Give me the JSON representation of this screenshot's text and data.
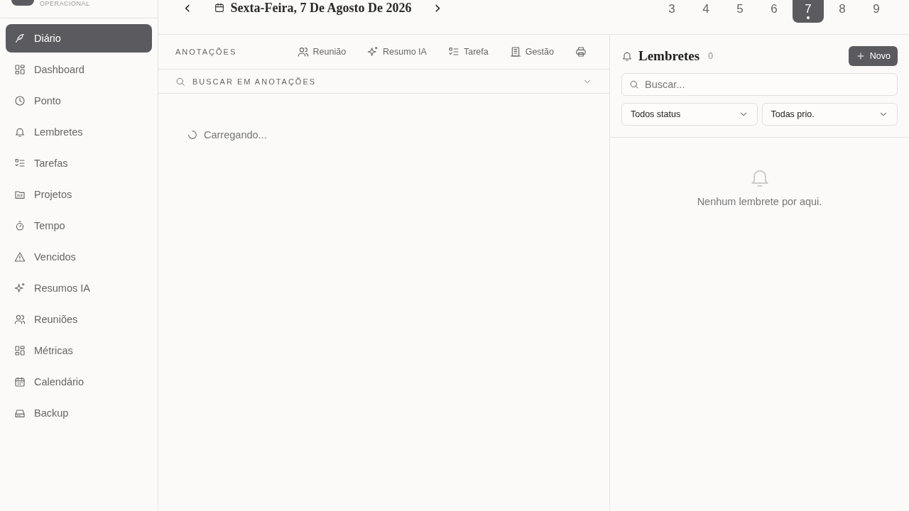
{
  "brand": {
    "subtitle": "OPERACIONAL"
  },
  "sidebar": {
    "items": [
      {
        "label": "Diário",
        "selected": true
      },
      {
        "label": "Dashboard",
        "selected": false
      },
      {
        "label": "Ponto",
        "selected": false
      },
      {
        "label": "Lembretes",
        "selected": false
      },
      {
        "label": "Tarefas",
        "selected": false
      },
      {
        "label": "Projetos",
        "selected": false
      },
      {
        "label": "Tempo",
        "selected": false
      },
      {
        "label": "Vencidos",
        "selected": false
      },
      {
        "label": "Resumos IA",
        "selected": false
      },
      {
        "label": "Reuniões",
        "selected": false
      },
      {
        "label": "Métricas",
        "selected": false
      },
      {
        "label": "Calendário",
        "selected": false
      },
      {
        "label": "Backup",
        "selected": false
      }
    ]
  },
  "date_nav": {
    "prev": "‹",
    "date": "Sexta-Feira, 7 De Agosto De 2026",
    "next": "›"
  },
  "days": [
    {
      "label": "3",
      "selected": false
    },
    {
      "label": "4",
      "selected": false
    },
    {
      "label": "5",
      "selected": false
    },
    {
      "label": "6",
      "selected": false
    },
    {
      "label": "7",
      "selected": true
    },
    {
      "label": "8",
      "selected": false
    },
    {
      "label": "9",
      "selected": false
    }
  ],
  "notes": {
    "title": "ANOTAÇÕES",
    "actions": [
      {
        "label": "Reunião"
      },
      {
        "label": "Resumo IA"
      },
      {
        "label": "Tarefa"
      },
      {
        "label": "Gestão"
      }
    ],
    "search": {
      "placeholder": "BUSCAR EM ANOTAÇÕES"
    },
    "loading": "Carregando..."
  },
  "reminders": {
    "title": "Lembretes",
    "count": "0",
    "new_button": "Novo",
    "search": {
      "placeholder": "Buscar..."
    },
    "filters": [
      "Todos status",
      "Todas prio."
    ],
    "empty": "Nenhum lembrete por aqui."
  }
}
